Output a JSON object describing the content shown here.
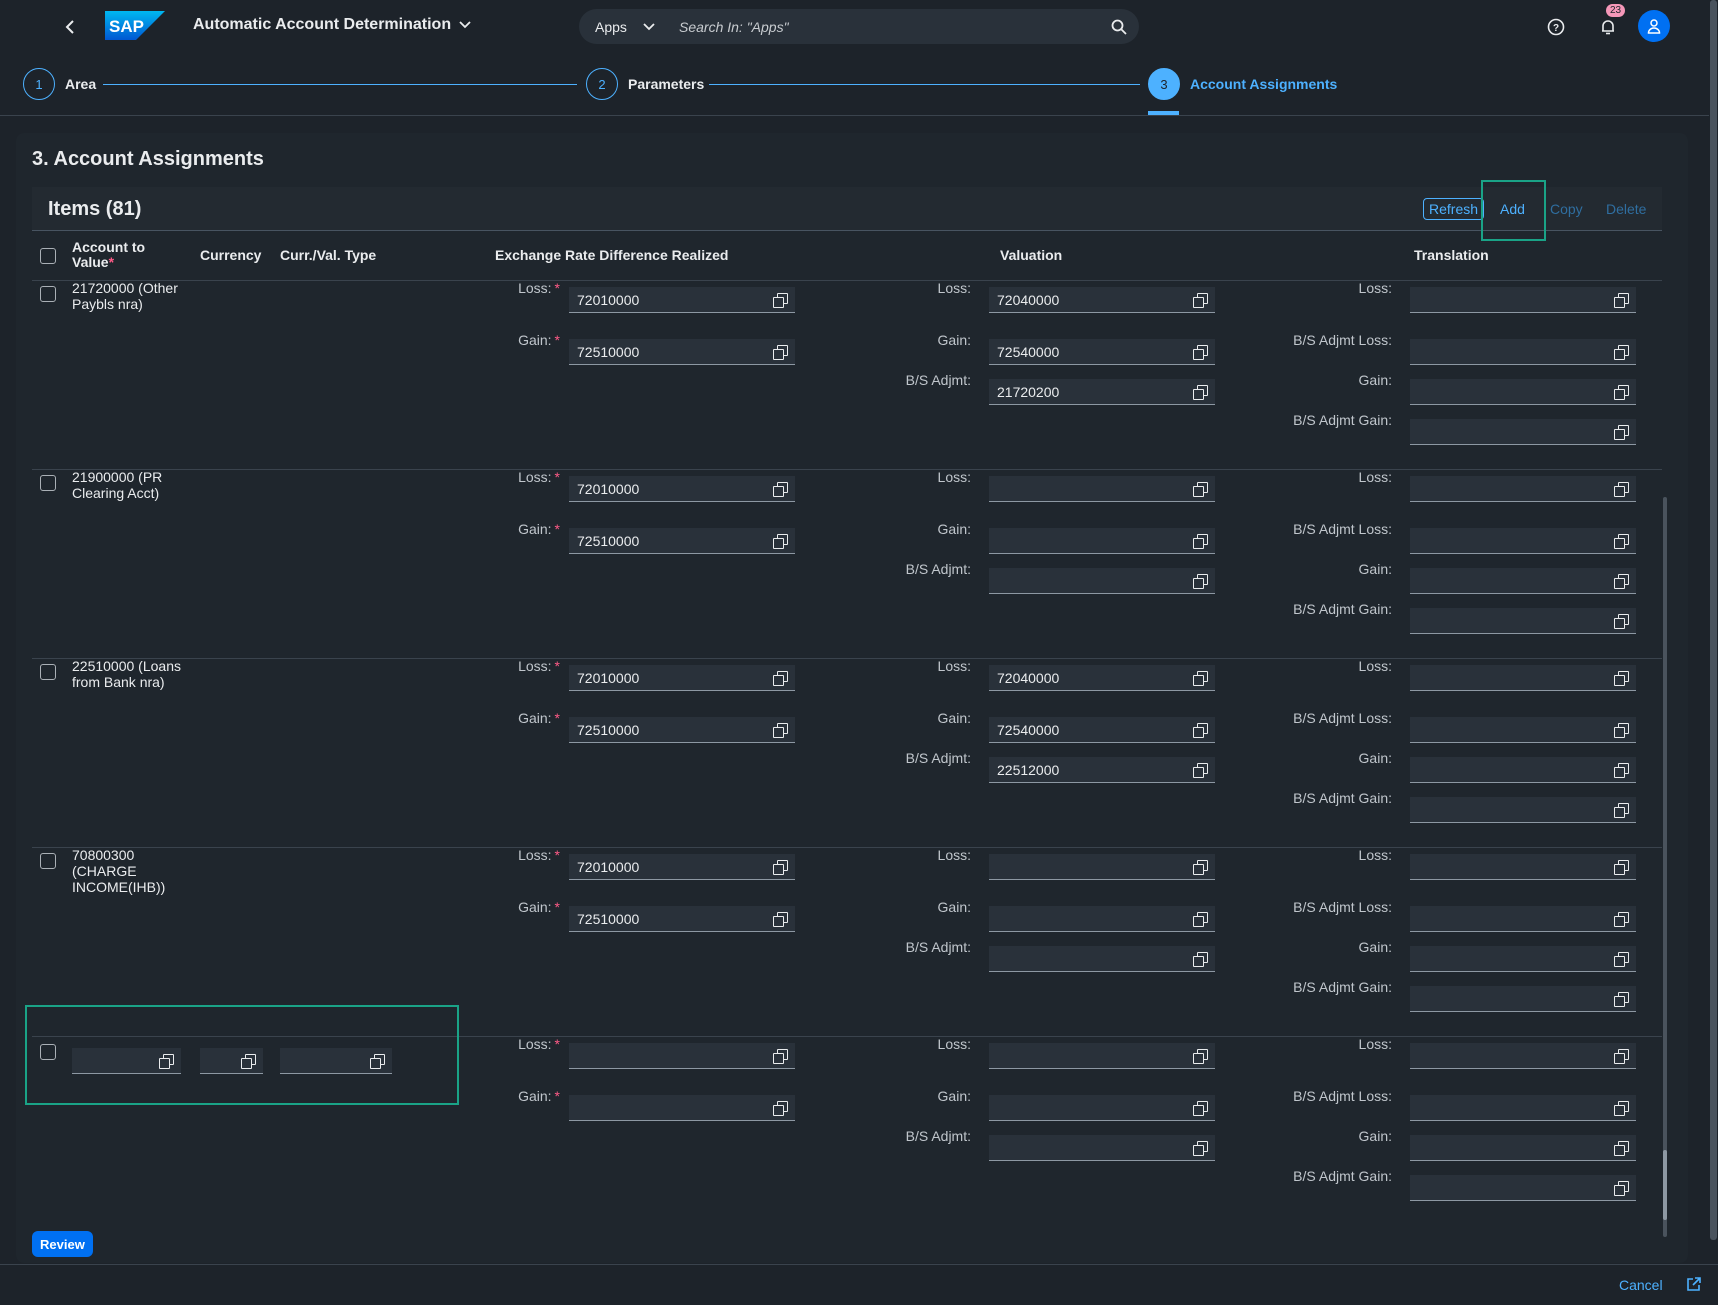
{
  "shell": {
    "title": "Automatic Account Determination",
    "search_scope": "Apps",
    "search_placeholder": "Search In: \"Apps\"",
    "notifications_count": "23",
    "brand_color": "#0070f2"
  },
  "wizard": {
    "steps": [
      {
        "num": "1",
        "label": "Area"
      },
      {
        "num": "2",
        "label": "Parameters"
      },
      {
        "num": "3",
        "label": "Account Assignments"
      }
    ]
  },
  "section": {
    "title": "3. Account Assignments",
    "items_title": "Items (81)",
    "toolbar": {
      "refresh": "Refresh",
      "add": "Add",
      "copy": "Copy",
      "delete": "Delete"
    }
  },
  "columns": {
    "account_line1": "Account to",
    "account_line2": "Value",
    "currency": "Currency",
    "curr_val_type": "Curr./Val. Type",
    "erd": "Exchange Rate Difference Realized",
    "valuation": "Valuation",
    "translation": "Translation",
    "required_mark": "*"
  },
  "labels": {
    "loss": "Loss:",
    "gain": "Gain:",
    "bs_adjmt": "B/S Adjmt:",
    "bs_adjmt_loss": "B/S Adjmt Loss:",
    "bs_adjmt_gain": "B/S Adjmt Gain:"
  },
  "rows": [
    {
      "acct": [
        "21720000 (Other",
        "Paybls nra)"
      ],
      "erd_loss": "72010000",
      "erd_gain": "72510000",
      "val_loss": "72040000",
      "val_gain": "72540000",
      "val_bs": "21720200"
    },
    {
      "acct": [
        "21900000 (PR",
        "Clearing Acct)"
      ],
      "erd_loss": "72010000",
      "erd_gain": "72510000",
      "val_loss": "",
      "val_gain": "",
      "val_bs": ""
    },
    {
      "acct": [
        "22510000 (Loans",
        "from Bank nra)"
      ],
      "erd_loss": "72010000",
      "erd_gain": "72510000",
      "val_loss": "72040000",
      "val_gain": "72540000",
      "val_bs": "22512000"
    },
    {
      "acct": [
        "70800300",
        "(CHARGE",
        "INCOME(IHB))"
      ],
      "erd_loss": "72010000",
      "erd_gain": "72510000",
      "val_loss": "",
      "val_gain": "",
      "val_bs": ""
    }
  ],
  "footer": {
    "review": "Review",
    "cancel": "Cancel"
  }
}
